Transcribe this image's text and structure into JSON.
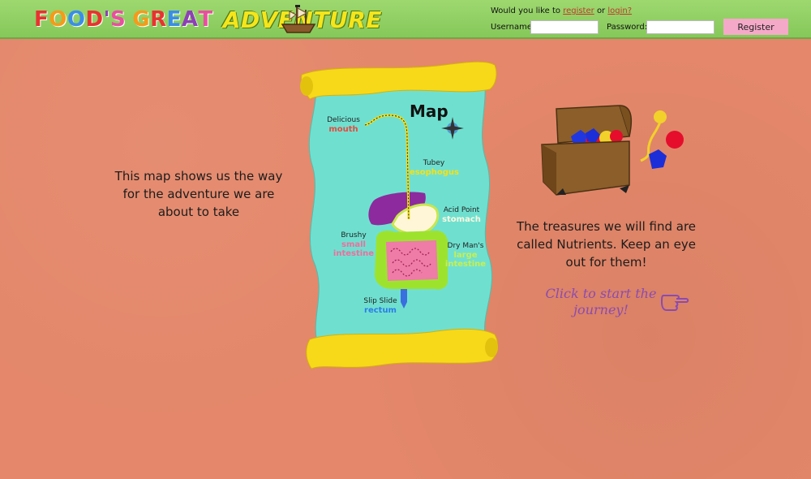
{
  "header": {
    "logo_letters": [
      "F",
      "O",
      "O",
      "D",
      "'",
      "S",
      " ",
      "G",
      "R",
      "E",
      "A",
      "T"
    ],
    "logo_adventure": "ADVENTURE",
    "auth": {
      "prompt_pre": "Would you like to",
      "register_link": "register",
      "or": "or",
      "login_link": "login?",
      "username_label": "Username:",
      "password_label": "Password:",
      "register_button": "Register"
    }
  },
  "left_text": "This map shows us the way for the adventure we are about to take",
  "right_text": "The treasures we will find are called Nutrients. Keep an eye out for them!",
  "cta": "Click to start the journey!",
  "map": {
    "title": "Map",
    "labels": [
      {
        "name": "Delicious",
        "value": "mouth"
      },
      {
        "name": "Tubey",
        "value": "esophogus"
      },
      {
        "name": "Acid Point",
        "value": "stomach"
      },
      {
        "name": "Brushy",
        "value": "small intestine"
      },
      {
        "name": "Dry Man's",
        "value": "large intestine"
      },
      {
        "name": "Slip Slide",
        "value": "rectum"
      }
    ]
  },
  "colors": {
    "background": "#e4876a",
    "header": "#8dce60",
    "map_paper": "#6fe0d0",
    "scroll_ends": "#f7d91a",
    "cta": "#8a4bb0",
    "register_button": "#f5a9c8"
  }
}
